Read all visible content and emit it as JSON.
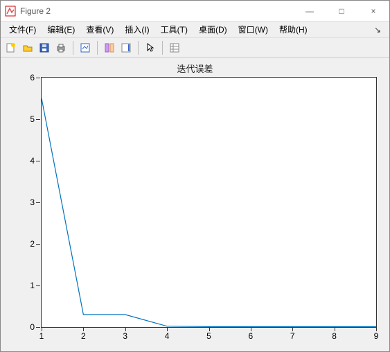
{
  "window": {
    "title": "Figure 2",
    "controls": {
      "minimize": "—",
      "maximize": "□",
      "close": "×"
    }
  },
  "menubar": {
    "items": [
      {
        "label": "文件(F)"
      },
      {
        "label": "编辑(E)"
      },
      {
        "label": "查看(V)"
      },
      {
        "label": "插入(I)"
      },
      {
        "label": "工具(T)"
      },
      {
        "label": "桌面(D)"
      },
      {
        "label": "窗口(W)"
      },
      {
        "label": "帮助(H)"
      }
    ]
  },
  "toolbar": {
    "icons": [
      "new-figure-icon",
      "open-icon",
      "save-icon",
      "print-icon",
      "|",
      "edit-plot-icon",
      "|",
      "link-icon",
      "insert-colorbar-icon",
      "|",
      "pointer-icon",
      "|",
      "project-icon"
    ]
  },
  "chart_data": {
    "type": "line",
    "title": "迭代误差",
    "x": [
      1,
      2,
      3,
      4,
      5,
      6,
      7,
      8,
      9
    ],
    "y": [
      5.5,
      0.3,
      0.3,
      0.02,
      0.01,
      0.01,
      0.01,
      0.01,
      0.01
    ],
    "xlim": [
      1,
      9
    ],
    "ylim": [
      0,
      6
    ],
    "xticks": [
      1,
      2,
      3,
      4,
      5,
      6,
      7,
      8,
      9
    ],
    "yticks": [
      0,
      1,
      2,
      3,
      4,
      5,
      6
    ]
  }
}
